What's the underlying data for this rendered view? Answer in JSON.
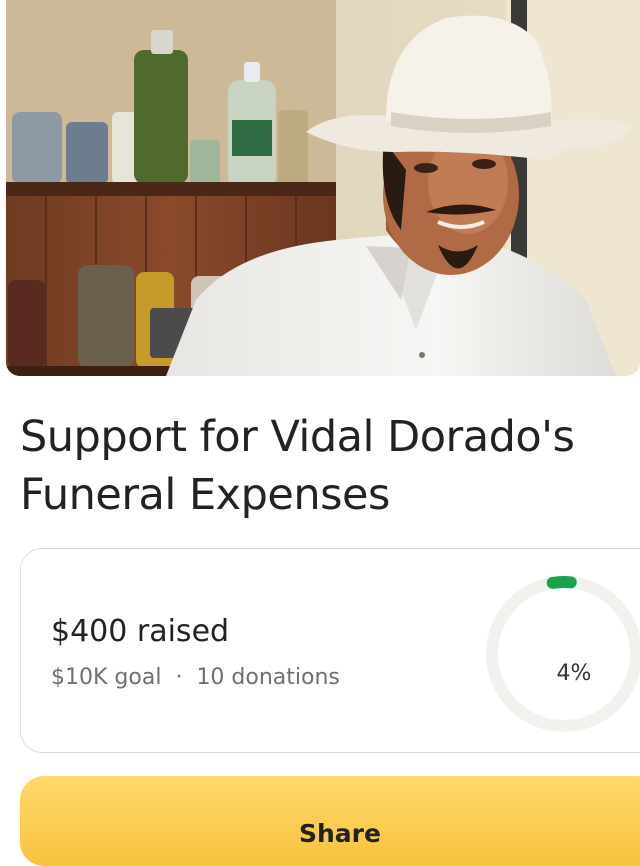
{
  "campaign": {
    "title": "Support for Vidal Dorado's Funeral Expenses",
    "photo_alt": "photo of a man in a white cowboy hat"
  },
  "stats": {
    "raised": "$400 raised",
    "goal": "$10K goal",
    "separator": "·",
    "donations": "10 donations",
    "percent_label": "4%",
    "progress_fraction": 0.04,
    "progress_color": "#1aa34a",
    "track_color": "#f1f1ed"
  },
  "actions": {
    "share_label": "Share",
    "share_color": "#f7c23d"
  }
}
